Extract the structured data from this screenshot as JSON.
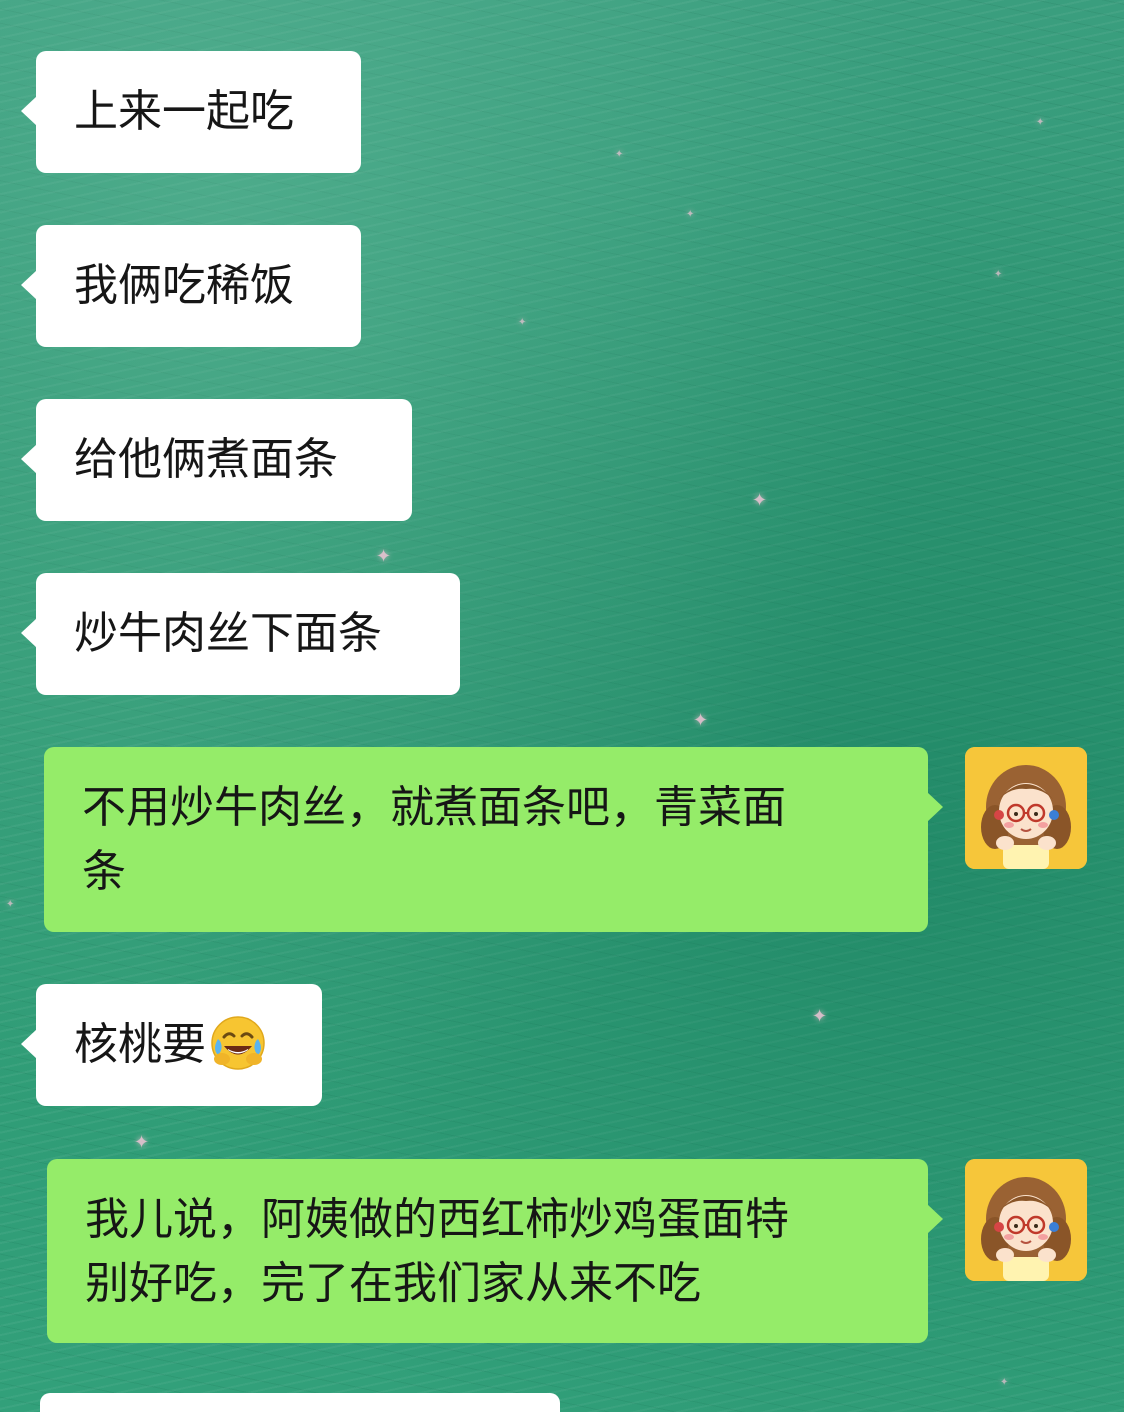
{
  "messages": [
    {
      "side": "incoming",
      "text": "上来一起吃"
    },
    {
      "side": "incoming",
      "text": "我俩吃稀饭"
    },
    {
      "side": "incoming",
      "text": "给他俩煮面条"
    },
    {
      "side": "incoming",
      "text": "炒牛肉丝下面条"
    },
    {
      "side": "outgoing",
      "line1": "不用炒牛肉丝，就煮面条吧，青菜面",
      "line2": "条"
    },
    {
      "side": "incoming",
      "text": "核桃要",
      "emoji": "face-with-tears-of-joy-emoji"
    },
    {
      "side": "outgoing",
      "line1": "我儿说，阿姨做的西红柿炒鸡蛋面特",
      "line2": "别好吃，完了在我们家从来不吃"
    }
  ],
  "colors": {
    "incoming_bubble": "#ffffff",
    "outgoing_bubble": "#95ec69",
    "background": "#2f9874",
    "text": "#161616"
  },
  "icons": {
    "avatar": "girl-with-glasses-avatar",
    "sparkle": "pink-sparkle-icon"
  }
}
